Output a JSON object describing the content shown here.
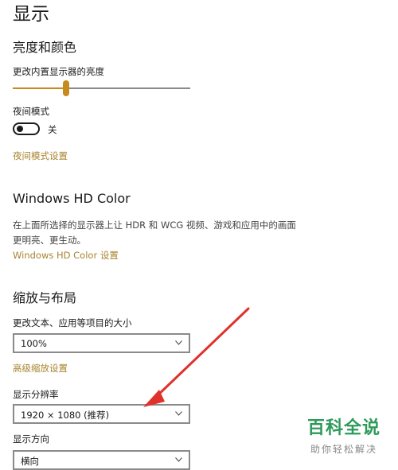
{
  "page": {
    "title": "显示"
  },
  "brightness": {
    "heading": "亮度和颜色",
    "slider_label": "更改内置显示器的亮度",
    "slider_value_percent": 30
  },
  "night_light": {
    "label": "夜间模式",
    "state_label": "关",
    "settings_link": "夜间模式设置"
  },
  "hdr": {
    "heading": "Windows HD Color",
    "description": "在上面所选择的显示器上让 HDR 和 WCG 视频、游戏和应用中的画面更明亮、更生动。",
    "settings_link": "Windows HD Color 设置"
  },
  "scale_layout": {
    "heading": "缩放与布局",
    "scale_label": "更改文本、应用等项目的大小",
    "scale_value": "100%",
    "advanced_link": "高级缩放设置",
    "resolution_label": "显示分辨率",
    "resolution_value": "1920 × 1080 (推荐)",
    "orientation_label": "显示方向",
    "orientation_value": "横向"
  },
  "annotation": {
    "arrow_color": "#e0312b"
  },
  "watermark": {
    "title": "百科全说",
    "subtitle": "助你轻松解决"
  },
  "colors": {
    "accent": "#c78a1c",
    "link": "#a8842f"
  }
}
